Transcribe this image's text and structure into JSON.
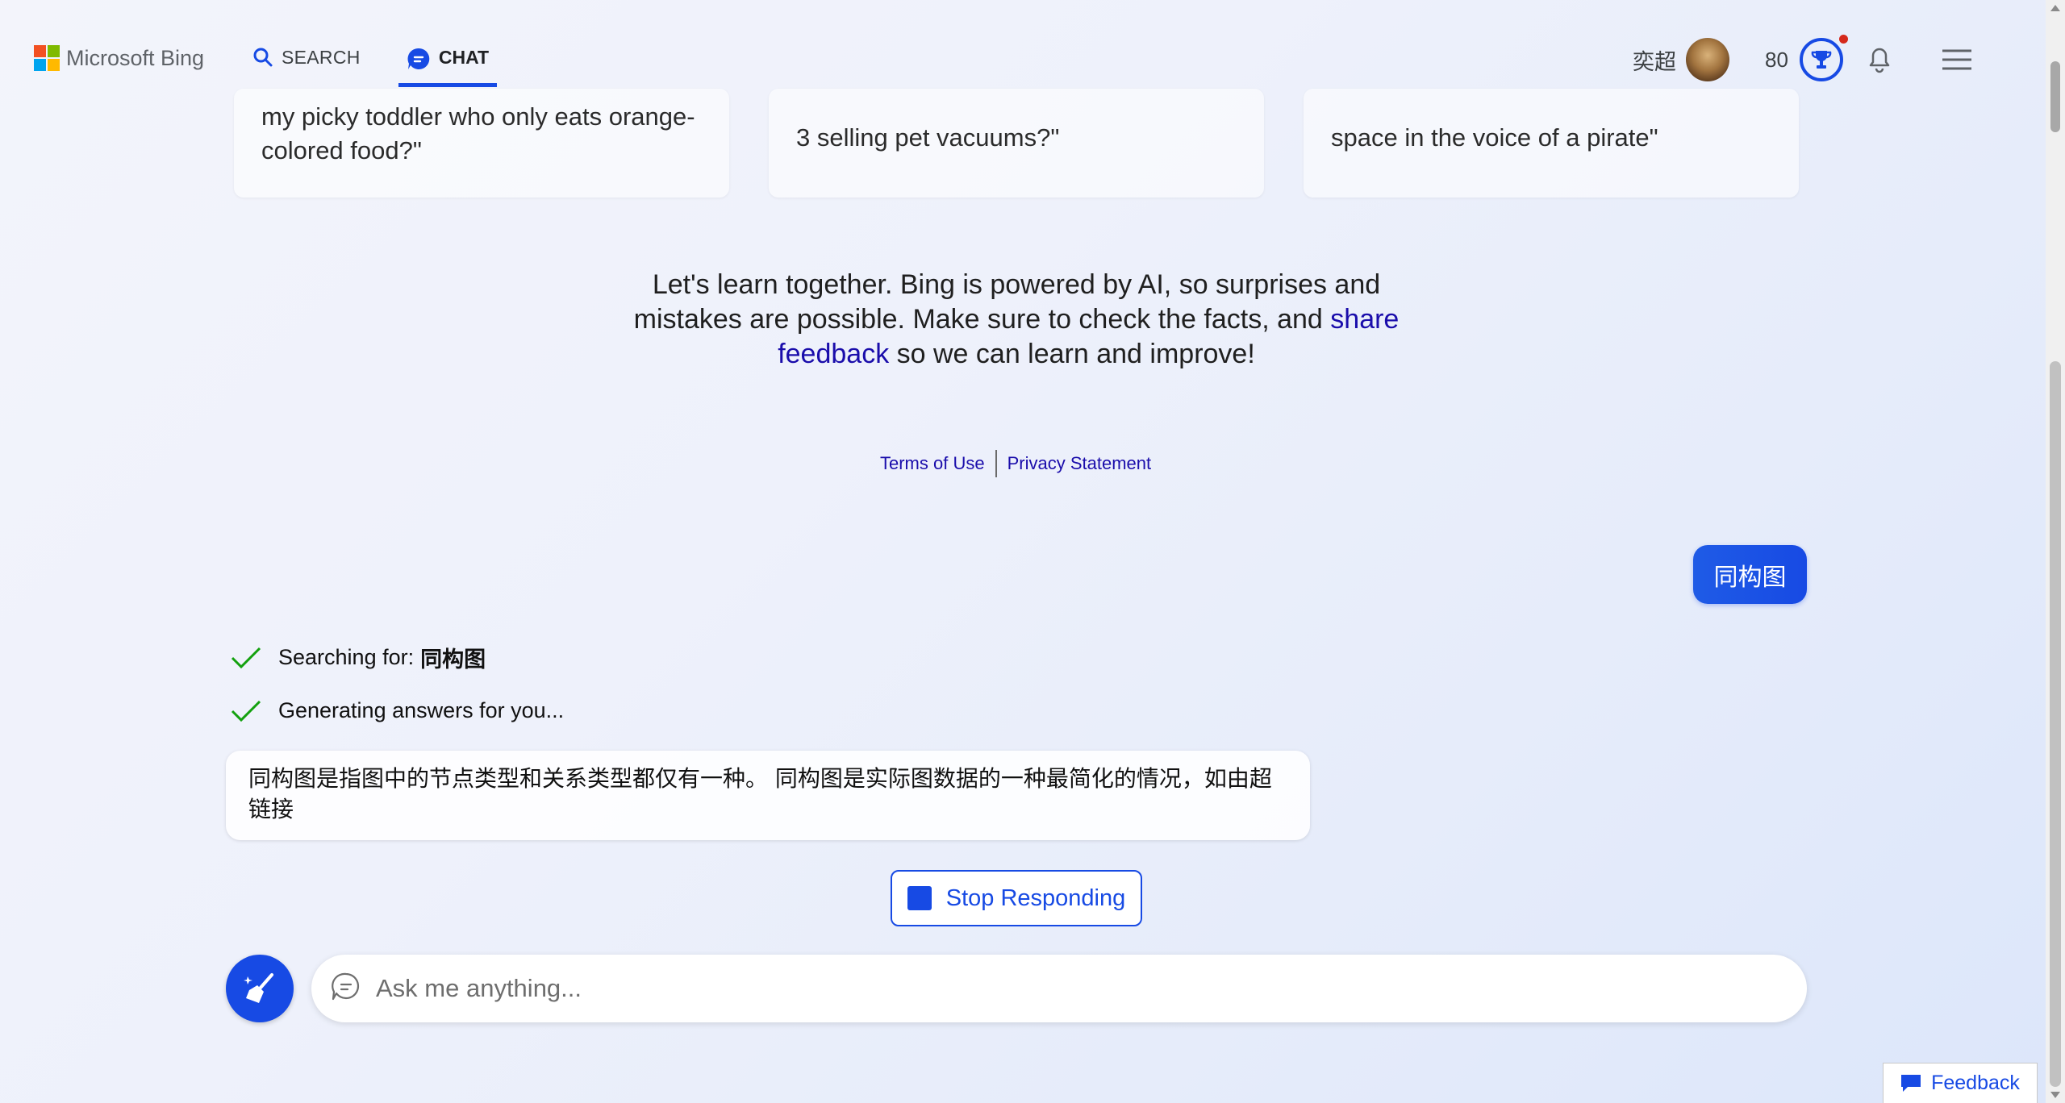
{
  "header": {
    "logo_text": "Microsoft Bing",
    "tabs": [
      {
        "label": "SEARCH",
        "icon": "search-icon"
      },
      {
        "label": "CHAT",
        "icon": "chat-icon",
        "active": true
      }
    ],
    "user_name": "奕超",
    "reward_points": "80"
  },
  "suggestions": [
    {
      "text": "my picky toddler who only eats orange-colored food?\""
    },
    {
      "text": "3 selling pet vacuums?\""
    },
    {
      "text": "space in the voice of a pirate\""
    }
  ],
  "disclaimer": {
    "text_before": "Let's learn together. Bing is powered by AI, so surprises and mistakes are possible. Make sure to check the facts, and ",
    "link": "share feedback",
    "text_after": " so we can learn and improve!"
  },
  "legal": {
    "terms": "Terms of Use",
    "privacy": "Privacy Statement"
  },
  "conversation": {
    "user_message": "同构图",
    "progress": [
      {
        "label": "Searching for:",
        "query": "同构图"
      },
      {
        "label": "Generating answers for you..."
      }
    ],
    "answer": "同构图是指图中的节点类型和关系类型都仅有一种。 同构图是实际图数据的一种最简化的情况，如由超链接"
  },
  "stop_button": {
    "label": "Stop Responding"
  },
  "composer": {
    "placeholder": "Ask me anything..."
  },
  "feedback": {
    "label": "Feedback"
  },
  "colors": {
    "accent": "#174ae4",
    "link": "#1a0dab",
    "check": "#13a10e",
    "notification_dot": "#d5281b"
  }
}
